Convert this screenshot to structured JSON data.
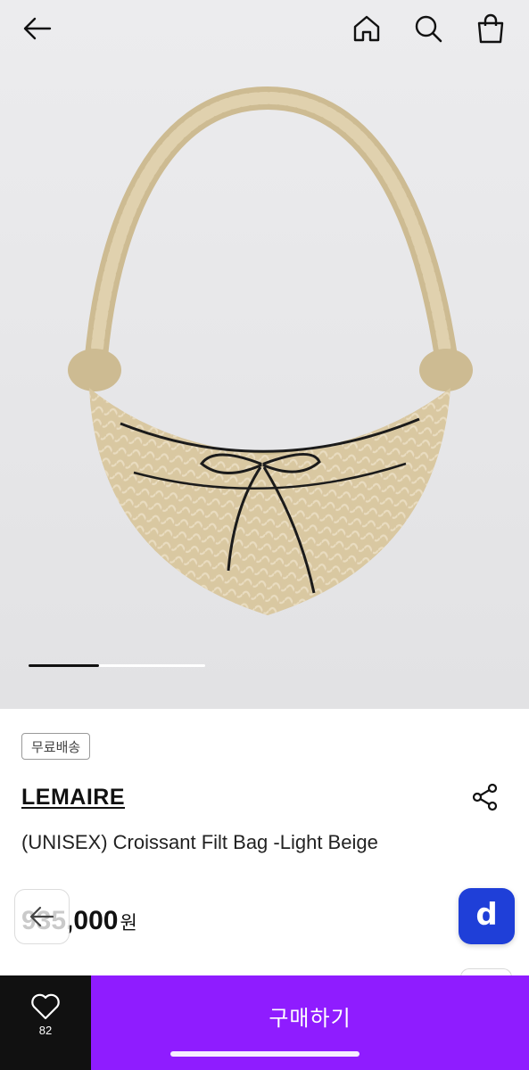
{
  "topbar": {
    "back_icon": "arrow-left-icon",
    "home_icon": "home-icon",
    "search_icon": "search-icon",
    "cart_icon": "shopping-bag-icon"
  },
  "gallery": {
    "image": "Beige net croissant shoulder bag with black leather bow tie",
    "progress": 0.4
  },
  "product": {
    "badge": "무료배송",
    "brand": "LEMAIRE",
    "title": "(UNISEX) Croissant Filt Bag -Light Beige",
    "price_number": "935,000",
    "price_unit": "원"
  },
  "floating": {
    "back_icon": "arrow-left-icon",
    "d_label": "d",
    "d_color": "#1f3fd8"
  },
  "bottom": {
    "like_icon": "heart-icon",
    "like_count": "82",
    "buy_label": "구매하기",
    "buy_color": "#8f1cff"
  }
}
